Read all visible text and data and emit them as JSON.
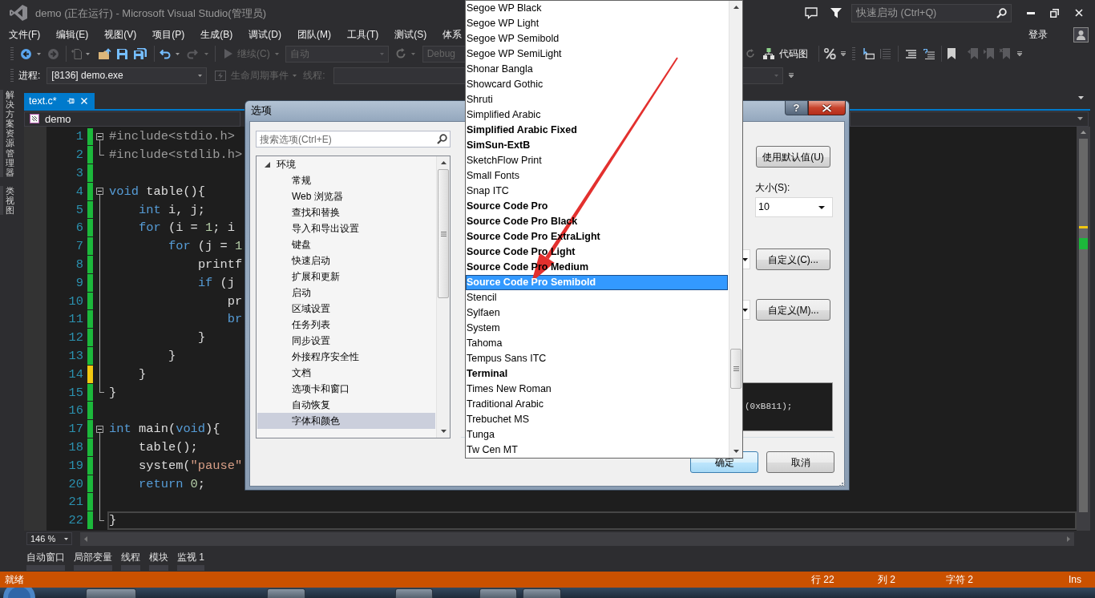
{
  "window": {
    "title": "demo (正在运行) - Microsoft Visual Studio(管理员)",
    "quick_launch": {
      "placeholder": "快速启动 (Ctrl+Q)"
    }
  },
  "menu": {
    "items": [
      "文件(F)",
      "编辑(E)",
      "视图(V)",
      "项目(P)",
      "生成(B)",
      "调试(D)",
      "团队(M)",
      "工具(T)",
      "测试(S)",
      "体系"
    ],
    "sign_in": "登录"
  },
  "toolbar": {
    "back": {
      "disabled": false
    },
    "forward": {
      "disabled": true
    },
    "undo": {
      "disabled": false
    },
    "redo": {
      "disabled": true
    },
    "continue": {
      "label": "继续(C)",
      "disabled": true
    },
    "config": {
      "value": "自动",
      "disabled": true
    },
    "platform": {
      "value": "Debug",
      "disabled": true
    },
    "code_map": {
      "label": "代码图"
    }
  },
  "debug_location": {
    "process_label": "进程:",
    "process": "[8136] demo.exe",
    "lifecycle": {
      "label": "生命周期事件",
      "disabled": true
    },
    "thread": {
      "label": "线程:",
      "disabled": true
    }
  },
  "side_tabs": [
    "解决方案资源管理器",
    "类视图"
  ],
  "document_tabs": [
    {
      "label": "text.c*",
      "selected": true
    }
  ],
  "navigation": {
    "project": "demo"
  },
  "editor": {
    "lines": [
      {
        "number": "1",
        "tokens": [
          {
            "kind": "preprocessor",
            "text": "#include<stdio.h>"
          }
        ],
        "kind": "start",
        "color": "#1cb83b",
        "current": false
      },
      {
        "number": "2",
        "tokens": [
          {
            "kind": "preprocessor",
            "text": "#include<stdlib.h>"
          }
        ],
        "kind": "end",
        "color": "#1cb83b",
        "current": false
      },
      {
        "number": "3",
        "kind": "outside",
        "color": "#1cb83b",
        "current": false
      },
      {
        "number": "4",
        "tokens": [
          {
            "kind": "keyword",
            "text": "void"
          },
          {
            "kind": "plain",
            "text": " table(){"
          }
        ],
        "kind": "start",
        "color": "#1cb83b",
        "current": false
      },
      {
        "number": "5",
        "tokens": [
          {
            "kind": "keyword",
            "text": "    int"
          },
          {
            "kind": "plain",
            "text": " i, j;"
          }
        ],
        "kind": "inside",
        "color": "#1cb83b",
        "current": false
      },
      {
        "number": "6",
        "tokens": [
          {
            "kind": "keyword",
            "text": "    for"
          },
          {
            "kind": "plain",
            "text": " (i = "
          },
          {
            "kind": "number",
            "text": "1"
          },
          {
            "kind": "plain",
            "text": "; i"
          }
        ],
        "kind": "inside",
        "color": "#1cb83b",
        "current": false
      },
      {
        "number": "7",
        "tokens": [
          {
            "kind": "keyword",
            "text": "        for"
          },
          {
            "kind": "plain",
            "text": " (j = "
          },
          {
            "kind": "number",
            "text": "1"
          }
        ],
        "kind": "inside",
        "color": "#1cb83b",
        "current": false
      },
      {
        "number": "8",
        "tokens": [
          {
            "kind": "plain",
            "text": "            printf"
          }
        ],
        "kind": "inside",
        "color": "#1cb83b",
        "current": false
      },
      {
        "number": "9",
        "tokens": [
          {
            "kind": "keyword",
            "text": "            if"
          },
          {
            "kind": "plain",
            "text": " (j"
          }
        ],
        "kind": "inside",
        "color": "#1cb83b",
        "current": false
      },
      {
        "number": "10",
        "tokens": [
          {
            "kind": "plain",
            "text": "                pr"
          }
        ],
        "kind": "inside",
        "color": "#1cb83b",
        "current": false
      },
      {
        "number": "11",
        "tokens": [
          {
            "kind": "keyword",
            "text": "                br"
          }
        ],
        "kind": "inside",
        "color": "#1cb83b",
        "current": false
      },
      {
        "number": "12",
        "tokens": [
          {
            "kind": "plain",
            "text": "            }"
          }
        ],
        "kind": "inside",
        "color": "#1cb83b",
        "current": false
      },
      {
        "number": "13",
        "tokens": [
          {
            "kind": "plain",
            "text": "        }"
          }
        ],
        "kind": "inside",
        "color": "#1cb83b",
        "current": false
      },
      {
        "number": "14",
        "tokens": [
          {
            "kind": "plain",
            "text": "    }"
          }
        ],
        "kind": "inside",
        "color": "#f2c811",
        "current": false
      },
      {
        "number": "15",
        "tokens": [
          {
            "kind": "plain",
            "text": "}"
          }
        ],
        "kind": "end",
        "color": "#1cb83b",
        "current": false
      },
      {
        "number": "16",
        "kind": "outside",
        "color": "#1cb83b",
        "current": false
      },
      {
        "number": "17",
        "tokens": [
          {
            "kind": "keyword",
            "text": "int"
          },
          {
            "kind": "plain",
            "text": " main("
          },
          {
            "kind": "keyword",
            "text": "void"
          },
          {
            "kind": "plain",
            "text": "){"
          }
        ],
        "kind": "start",
        "color": "#1cb83b",
        "current": false
      },
      {
        "number": "18",
        "tokens": [
          {
            "kind": "plain",
            "text": "    table();"
          }
        ],
        "kind": "inside",
        "color": "#1cb83b",
        "current": false
      },
      {
        "number": "19",
        "tokens": [
          {
            "kind": "plain",
            "text": "    system("
          },
          {
            "kind": "string",
            "text": "\"pause\""
          }
        ],
        "kind": "inside",
        "color": "#1cb83b",
        "current": false
      },
      {
        "number": "20",
        "tokens": [
          {
            "kind": "keyword",
            "text": "    return"
          },
          {
            "kind": "number",
            "text": " 0"
          },
          {
            "kind": "plain",
            "text": ";"
          }
        ],
        "kind": "inside",
        "color": "#1cb83b",
        "current": false
      },
      {
        "number": "21",
        "kind": "inside",
        "color": "#1cb83b",
        "current": false
      },
      {
        "number": "22",
        "tokens": [
          {
            "kind": "plain",
            "text": "}"
          }
        ],
        "kind": "end",
        "color": "#1cb83b",
        "current": true
      }
    ]
  },
  "zoom_level": "146 %",
  "tool_tabs": [
    "自动窗口",
    "局部变量",
    "线程",
    "模块",
    "监视 1"
  ],
  "status_bar": {
    "message": "就绪",
    "line": "行 22",
    "column": "列 2",
    "character": "字符 2",
    "mode": "Ins"
  },
  "options_dialog": {
    "title": "选项",
    "help_button": "?",
    "search": {
      "placeholder": "搜索选项(Ctrl+E)"
    },
    "tree": [
      {
        "label": "环境",
        "expanded": true,
        "selected": false,
        "children": [
          {
            "label": "常规",
            "selected": false
          },
          {
            "label": "Web 浏览器",
            "selected": false
          },
          {
            "label": "查找和替换",
            "selected": false
          },
          {
            "label": "导入和导出设置",
            "selected": false
          },
          {
            "label": "键盘",
            "selected": false
          },
          {
            "label": "快速启动",
            "selected": false
          },
          {
            "label": "扩展和更新",
            "selected": false
          },
          {
            "label": "启动",
            "selected": false
          },
          {
            "label": "区域设置",
            "selected": false
          },
          {
            "label": "任务列表",
            "selected": false
          },
          {
            "label": "同步设置",
            "selected": false
          },
          {
            "label": "外接程序安全性",
            "selected": false
          },
          {
            "label": "文档",
            "selected": false
          },
          {
            "label": "选项卡和窗口",
            "selected": false
          },
          {
            "label": "自动恢复",
            "selected": false
          },
          {
            "label": "字体和颜色",
            "selected": true
          }
        ]
      }
    ],
    "default_button": "使用默认值(U)",
    "size": {
      "label": "大小(S):",
      "value": "10"
    },
    "custom_item_button": "自定义(C)...",
    "custom_back_button": "自定义(M)...",
    "preview": "(0xB811);",
    "ok": "确定",
    "cancel": "取消"
  },
  "font_list": {
    "items": [
      {
        "name": "Segoe WP Black",
        "bold": false,
        "selected": false
      },
      {
        "name": "Segoe WP Light",
        "bold": false,
        "selected": false
      },
      {
        "name": "Segoe WP Semibold",
        "bold": false,
        "selected": false
      },
      {
        "name": "Segoe WP SemiLight",
        "bold": false,
        "selected": false
      },
      {
        "name": "Shonar Bangla",
        "bold": false,
        "selected": false
      },
      {
        "name": "Showcard Gothic",
        "bold": false,
        "selected": false
      },
      {
        "name": "Shruti",
        "bold": false,
        "selected": false
      },
      {
        "name": "Simplified Arabic",
        "bold": false,
        "selected": false
      },
      {
        "name": "Simplified Arabic Fixed",
        "bold": true,
        "selected": false
      },
      {
        "name": "SimSun-ExtB",
        "bold": true,
        "selected": false
      },
      {
        "name": "SketchFlow Print",
        "bold": false,
        "selected": false
      },
      {
        "name": "Small Fonts",
        "bold": false,
        "selected": false
      },
      {
        "name": "Snap ITC",
        "bold": false,
        "selected": false
      },
      {
        "name": "Source Code Pro",
        "bold": true,
        "selected": false
      },
      {
        "name": "Source Code Pro Black",
        "bold": true,
        "selected": false
      },
      {
        "name": "Source Code Pro ExtraLight",
        "bold": true,
        "selected": false
      },
      {
        "name": "Source Code Pro Light",
        "bold": true,
        "selected": false
      },
      {
        "name": "Source Code Pro Medium",
        "bold": true,
        "selected": false
      },
      {
        "name": "Source Code Pro Semibold",
        "bold": true,
        "selected": true
      },
      {
        "name": "Stencil",
        "bold": false,
        "selected": false
      },
      {
        "name": "Sylfaen",
        "bold": false,
        "selected": false
      },
      {
        "name": "System",
        "bold": false,
        "selected": false
      },
      {
        "name": "Tahoma",
        "bold": false,
        "selected": false
      },
      {
        "name": "Tempus Sans ITC",
        "bold": false,
        "selected": false
      },
      {
        "name": "Terminal",
        "bold": true,
        "selected": false
      },
      {
        "name": "Times New Roman",
        "bold": false,
        "selected": false
      },
      {
        "name": "Traditional Arabic",
        "bold": false,
        "selected": false
      },
      {
        "name": "Trebuchet MS",
        "bold": false,
        "selected": false
      },
      {
        "name": "Tunga",
        "bold": false,
        "selected": false
      },
      {
        "name": "Tw Cen MT",
        "bold": false,
        "selected": false
      }
    ]
  }
}
